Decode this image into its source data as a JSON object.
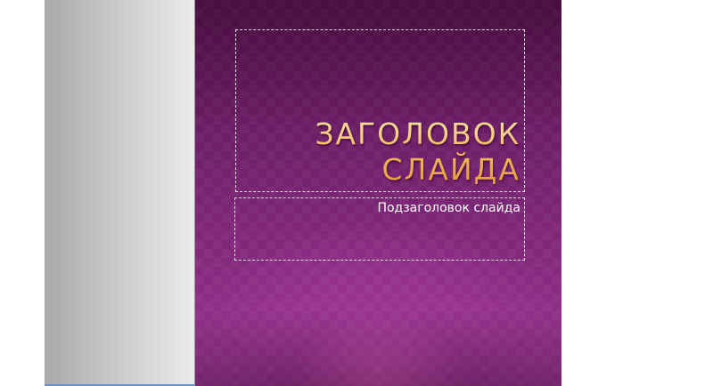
{
  "slide": {
    "title_line1": "ЗАГОЛОВОК",
    "title_line2": "СЛАЙДА",
    "subtitle": "Подзаголовок слайда"
  },
  "colors": {
    "slide_background": "#7a2470",
    "title_gold": "#f3b55a",
    "left_panel_gray": "#c8c8c8"
  }
}
